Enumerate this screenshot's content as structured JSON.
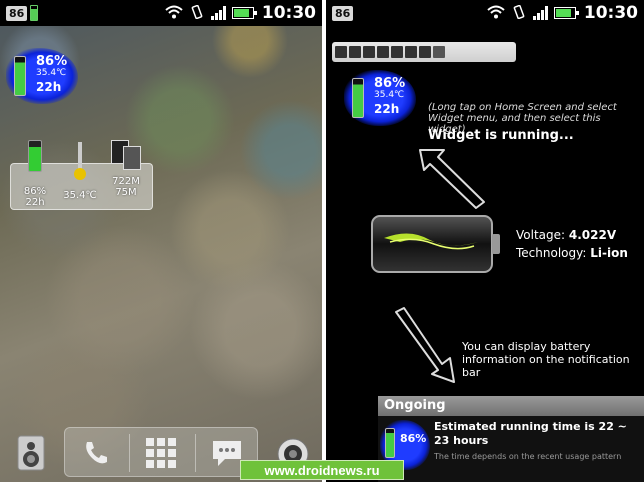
{
  "status_bar": {
    "badge": "86",
    "time": "10:30"
  },
  "left_screen": {
    "blue_widget": {
      "percent": "86%",
      "temperature": "35.4℃",
      "remaining": "22h"
    },
    "stats_widget": {
      "battery": {
        "percent": "86%",
        "remaining": "22h"
      },
      "temperature": "35.4℃",
      "memory": {
        "value1": "722M",
        "value2": "75M"
      }
    },
    "dock": {
      "items": [
        "phone-icon",
        "apps-grid-icon",
        "messages-icon"
      ]
    },
    "side_icons": {
      "left": "speaker-icon",
      "right": "camera-icon"
    }
  },
  "right_screen": {
    "blue_widget": {
      "percent": "86%",
      "temperature": "35.4℃",
      "remaining": "22h"
    },
    "hint": "(Long tap on Home Screen and select Widget menu, and then select this widget)",
    "running": "Widget is running...",
    "voltage_label": "Voltage:",
    "voltage_value": "4.022V",
    "technology_label": "Technology:",
    "technology_value": "Li-ion",
    "notification_text": "You can display battery information on the notification bar",
    "ongoing": {
      "header": "Ongoing",
      "percent": "86%",
      "title": "Estimated running time is 22 ~ 23 hours",
      "subtitle": "The time depends on the recent usage pattern"
    }
  },
  "watermark": "www.droidnews.ru",
  "colors": {
    "widget_blue": "#1f3cff",
    "battery_green": "#4c4",
    "watermark_green": "#6fc23a"
  }
}
